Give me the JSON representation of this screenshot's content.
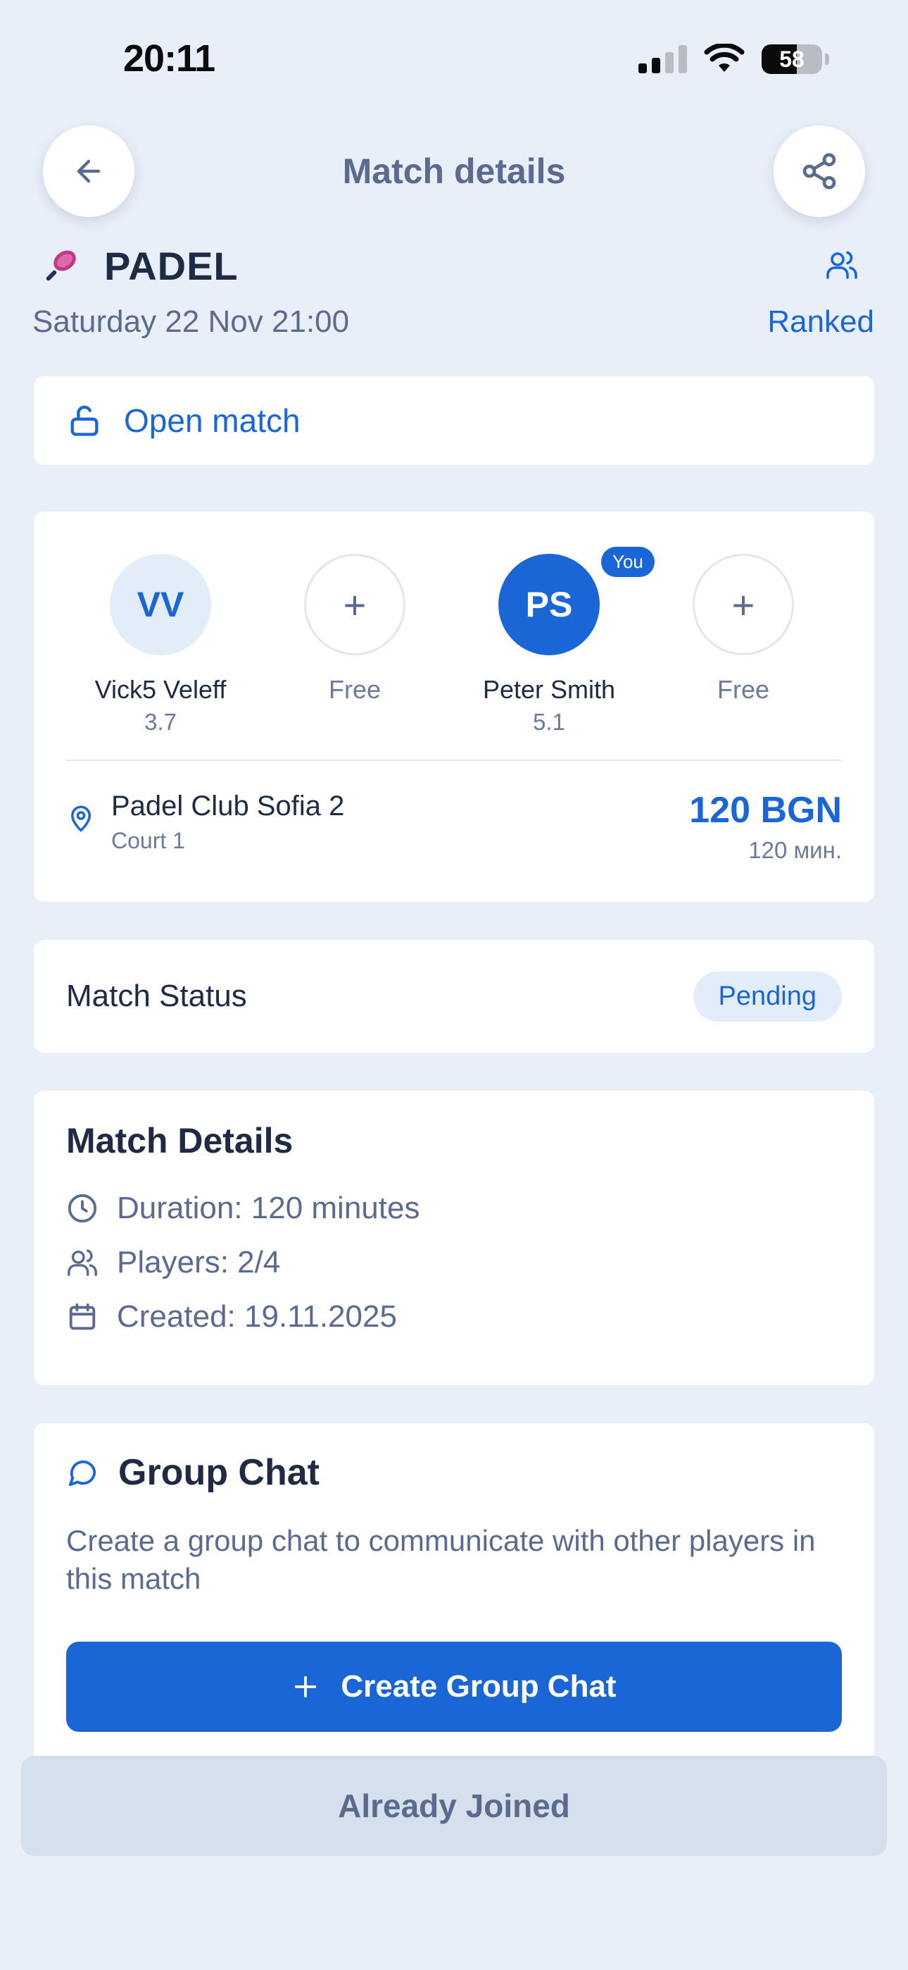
{
  "status_bar": {
    "time": "20:11",
    "battery": "58"
  },
  "header": {
    "title": "Match details"
  },
  "match": {
    "sport": "PADEL",
    "date_time": "Saturday 22 Nov 21:00",
    "ranked_label": "Ranked",
    "open_label": "Open match"
  },
  "players": [
    {
      "initials": "VV",
      "name": "Vick5 Veleff",
      "rating": "3.7"
    },
    {
      "initials": "+",
      "name": "Free",
      "rating": ""
    },
    {
      "initials": "PS",
      "name": "Peter Smith",
      "rating": "5.1",
      "badge": "You"
    },
    {
      "initials": "+",
      "name": "Free",
      "rating": ""
    }
  ],
  "venue": {
    "name": "Padel Club Sofia 2",
    "court": "Court 1",
    "price": "120 BGN",
    "duration": "120 мин."
  },
  "status": {
    "label": "Match Status",
    "value": "Pending"
  },
  "details": {
    "title": "Match Details",
    "duration": "Duration: 120 minutes",
    "players": "Players: 2/4",
    "created": "Created: 19.11.2025"
  },
  "chat": {
    "title": "Group Chat",
    "description": "Create a group chat to communicate with other players in this match",
    "button_label": "Create Group Chat"
  },
  "footer": {
    "joined_label": "Already Joined"
  },
  "colors": {
    "accent": "#1a66d6",
    "background": "#e8eff9",
    "muted": "#5a6b8f"
  }
}
